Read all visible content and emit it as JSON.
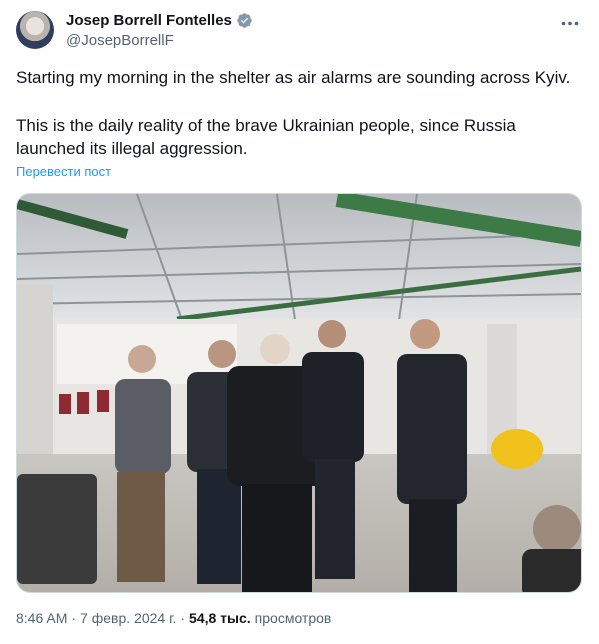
{
  "author": {
    "display_name": "Josep Borrell Fontelles",
    "handle": "@JosepBorrellF",
    "verified_badge": "verified-badge-icon"
  },
  "menu_icon": "more-options-icon",
  "post": {
    "paragraph_1": "Starting my morning in the shelter as air alarms are sounding across Kyiv.",
    "paragraph_2": "This is the daily reality of the brave Ukrainian people, since Russia launched its illegal aggression.",
    "translate_link": "Перевести пост"
  },
  "photo": {
    "description_icon": "attached-photo"
  },
  "footer": {
    "time": "8:46 AM",
    "sep1": "·",
    "date": "7 февр. 2024 г.",
    "sep2": "·",
    "views_count": "54,8 тыс.",
    "views_label": "просмотров"
  },
  "colors": {
    "link": "#1d9bf0",
    "secondary_text": "#536471",
    "primary_text": "#0f1419",
    "verified": "#829aab"
  }
}
